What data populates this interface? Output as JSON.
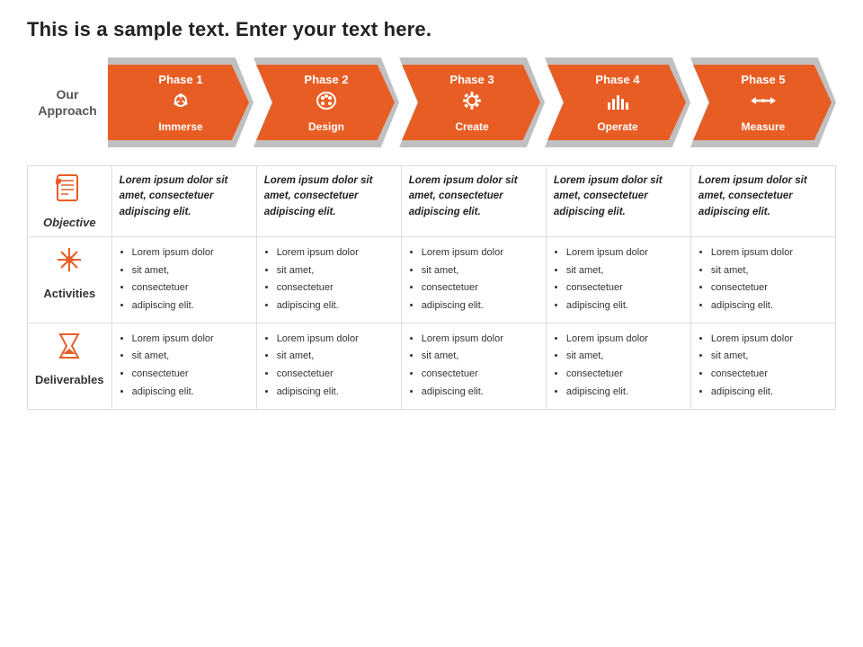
{
  "title": "This is a sample text. Enter your text here.",
  "approach_label": "Our\nApproach",
  "phases": [
    {
      "id": 1,
      "label": "Phase 1",
      "icon": "⛣",
      "name": "Immerse",
      "color": "#e85d24"
    },
    {
      "id": 2,
      "label": "Phase 2",
      "icon": "🎨",
      "name": "Design",
      "color": "#e85d24"
    },
    {
      "id": 3,
      "label": "Phase 3",
      "icon": "⚙",
      "name": "Create",
      "color": "#e85d24"
    },
    {
      "id": 4,
      "label": "Phase 4",
      "icon": "📶",
      "name": "Operate",
      "color": "#e85d24"
    },
    {
      "id": 5,
      "label": "Phase 5",
      "icon": "↔",
      "name": "Measure",
      "color": "#e85d24"
    }
  ],
  "rows": {
    "objective": {
      "label": "Objective",
      "cells": [
        "Lorem ipsum dolor sit amet, consectetuer adipiscing elit.",
        "Lorem ipsum dolor sit amet, consectetuer adipiscing elit.",
        "Lorem ipsum dolor sit amet, consectetuer adipiscing elit.",
        "Lorem ipsum dolor sit amet, consectetuer adipiscing elit.",
        "Lorem ipsum dolor sit amet, consectetuer adipiscing elit."
      ]
    },
    "activities": {
      "label": "Activities",
      "cells": [
        [
          "Lorem ipsum dolor",
          "sit amet,",
          "consectetuer",
          "adipiscing elit."
        ],
        [
          "Lorem ipsum dolor",
          "sit amet,",
          "consectetuer",
          "adipiscing elit."
        ],
        [
          "Lorem ipsum dolor",
          "sit amet,",
          "consectetuer",
          "adipiscing elit."
        ],
        [
          "Lorem ipsum dolor",
          "sit amet,",
          "consectetuer",
          "adipiscing elit."
        ],
        [
          "Lorem ipsum dolor",
          "sit amet,",
          "consectetuer",
          "adipiscing elit."
        ]
      ]
    },
    "deliverables": {
      "label": "Deliverables",
      "cells": [
        [
          "Lorem ipsum dolor",
          "sit amet,",
          "consectetuer",
          "adipiscing elit."
        ],
        [
          "Lorem ipsum dolor",
          "sit amet,",
          "consectetuer",
          "adipiscing elit."
        ],
        [
          "Lorem ipsum dolor",
          "sit amet,",
          "consectetuer",
          "adipiscing elit."
        ],
        [
          "Lorem ipsum dolor",
          "sit amet,",
          "consectetuer",
          "adipiscing elit."
        ],
        [
          "Lorem ipsum dolor",
          "sit amet,",
          "consectetuer",
          "adipiscing elit."
        ]
      ]
    }
  },
  "colors": {
    "orange": "#e85d24",
    "gray": "#b0b0b0",
    "light_gray": "#d0d0d0"
  }
}
